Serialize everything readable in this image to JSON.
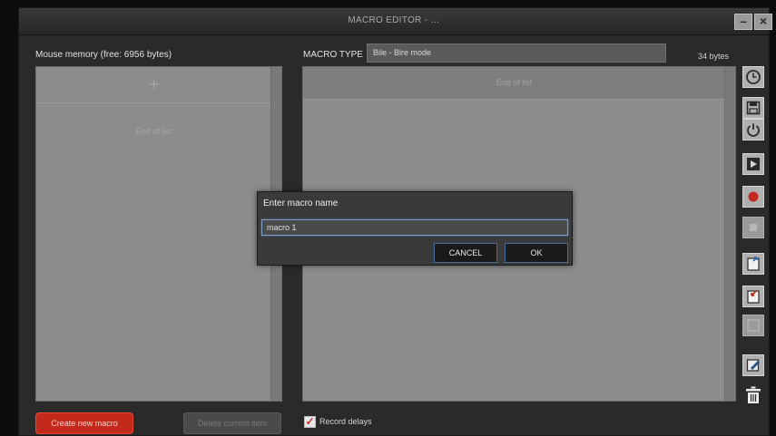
{
  "window": {
    "title": "MACRO EDITOR - …",
    "minimize_glyph": "–",
    "close_glyph": "×"
  },
  "header": {
    "memory_label": "Mouse memory (free: 6956 bytes)",
    "macro_type_label": "MACRO TYPE",
    "macro_type_value": "Bile - Bire mode",
    "bytes_label": "34 bytes"
  },
  "left_panel": {
    "add_glyph": "+",
    "end_of_list": "End of list"
  },
  "right_panel": {
    "end_of_list": "End of list"
  },
  "toolbar": {
    "icons": [
      "clock-icon",
      "save-icon",
      "power-icon",
      "play-icon",
      "record-icon",
      "stop-icon",
      "export-icon",
      "import-icon",
      "blank-icon",
      "edit-icon",
      "trash-icon"
    ]
  },
  "footer": {
    "create_button": "Create new macro",
    "delete_button": "Delete current item",
    "record_delays_checked": true,
    "record_delays_label": "Record delays",
    "checkbox_mark": "✓"
  },
  "dialog": {
    "title": "Enter macro name",
    "input_value": "macro 1",
    "cancel_label": "CANCEL",
    "ok_label": "OK"
  },
  "colors": {
    "accent_red": "#c42a1b",
    "focus_blue": "#7ea0c8",
    "panel_grey": "#8c8c8c"
  }
}
